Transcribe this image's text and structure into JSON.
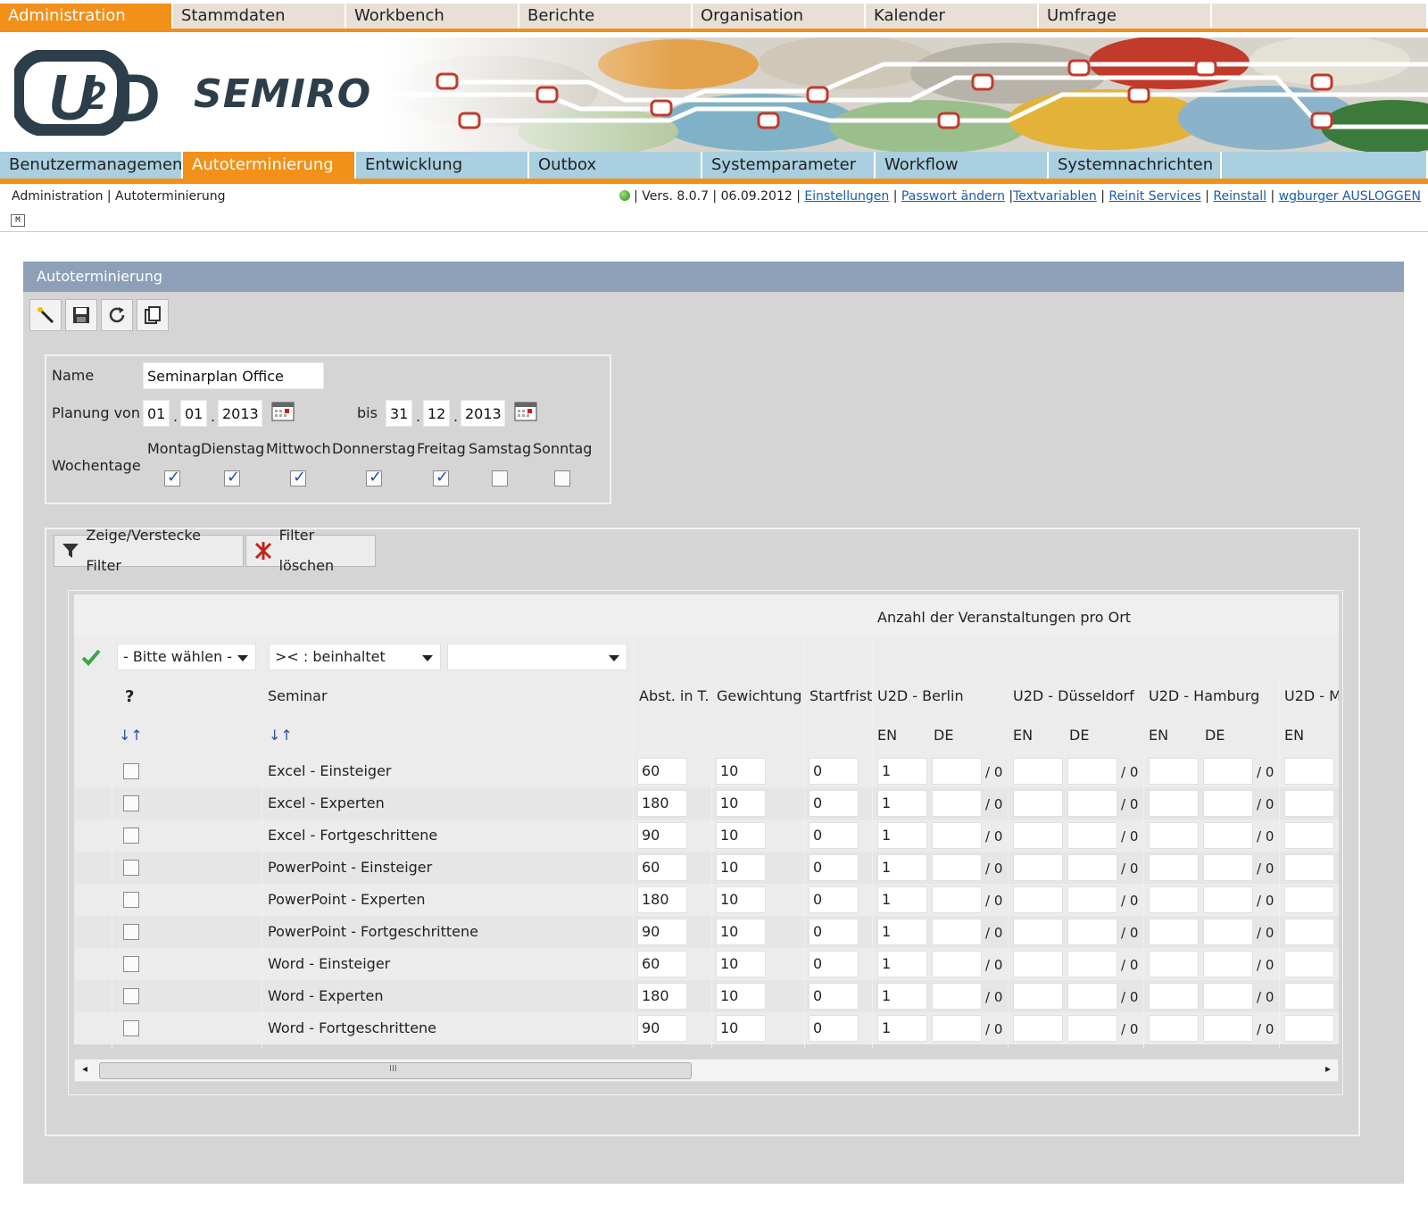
{
  "top_nav": {
    "tabs": [
      "Administration",
      "Stammdaten",
      "Workbench",
      "Berichte",
      "Organisation",
      "Kalender",
      "Umfrage"
    ],
    "active": "Administration"
  },
  "brand": {
    "logo_text": "U2D",
    "product": "SEMIRO"
  },
  "sub_nav": {
    "tabs": [
      "Benutzermanagement",
      "Autoterminierung",
      "Entwicklung",
      "Outbox",
      "Systemparameter",
      "Workflow",
      "Systemnachrichten"
    ],
    "active": "Autoterminierung"
  },
  "info_bar": {
    "breadcrumb": "Administration | Autoterminierung",
    "version": "| Vers. 8.0.7 | 06.09.2012 |",
    "links": [
      "Einstellungen",
      "Passwort ändern",
      "Textvariablen",
      "Reinit Services",
      "Reinstall",
      "wgburger AUSLOGGEN"
    ]
  },
  "panel": {
    "title": "Autoterminierung"
  },
  "form": {
    "name_label": "Name",
    "name_value": "Seminarplan Office",
    "planning_label": "Planung von",
    "from": {
      "day": "01",
      "month": "01",
      "year": "2013"
    },
    "to_label": "bis",
    "to": {
      "day": "31",
      "month": "12",
      "year": "2013"
    },
    "weekdays_label": "Wochentage",
    "weekdays": [
      {
        "name": "Montag",
        "checked": true
      },
      {
        "name": "Dienstag",
        "checked": true
      },
      {
        "name": "Mittwoch",
        "checked": true
      },
      {
        "name": "Donnerstag",
        "checked": true
      },
      {
        "name": "Freitag",
        "checked": true
      },
      {
        "name": "Samstag",
        "checked": false
      },
      {
        "name": "Sonntag",
        "checked": false
      }
    ]
  },
  "filter_bar": {
    "toggle_label": "Zeige/Verstecke Filter",
    "clear_label": "Filter löschen",
    "field_select": "- Bitte wählen -",
    "operator_select": "><  : beinhaltet",
    "filter_value": ""
  },
  "table": {
    "group_header": "Anzahl der Veranstaltungen pro Ort",
    "headers": {
      "help": "?",
      "seminar": "Seminar",
      "abst": "Abst. in T.",
      "gewichtung": "Gewichtung",
      "startfrist": "Startfrist"
    },
    "locations": [
      "U2D - Berlin",
      "U2D - Düsseldorf",
      "U2D - Hamburg",
      "U2D - M"
    ],
    "lang_en": "EN",
    "lang_de": "DE",
    "total_suffix": "/ 0",
    "rows": [
      {
        "seminar": "Excel - Einsteiger",
        "abst": "60",
        "gewichtung": "10",
        "startfrist": "0",
        "berlin_en": "1"
      },
      {
        "seminar": "Excel - Experten",
        "abst": "180",
        "gewichtung": "10",
        "startfrist": "0",
        "berlin_en": "1"
      },
      {
        "seminar": "Excel - Fortgeschrittene",
        "abst": "90",
        "gewichtung": "10",
        "startfrist": "0",
        "berlin_en": "1"
      },
      {
        "seminar": "PowerPoint - Einsteiger",
        "abst": "60",
        "gewichtung": "10",
        "startfrist": "0",
        "berlin_en": "1"
      },
      {
        "seminar": "PowerPoint - Experten",
        "abst": "180",
        "gewichtung": "10",
        "startfrist": "0",
        "berlin_en": "1"
      },
      {
        "seminar": "PowerPoint - Fortgeschrittene",
        "abst": "90",
        "gewichtung": "10",
        "startfrist": "0",
        "berlin_en": "1"
      },
      {
        "seminar": "Word - Einsteiger",
        "abst": "60",
        "gewichtung": "10",
        "startfrist": "0",
        "berlin_en": "1"
      },
      {
        "seminar": "Word - Experten",
        "abst": "180",
        "gewichtung": "10",
        "startfrist": "0",
        "berlin_en": "1"
      },
      {
        "seminar": "Word - Fortgeschrittene",
        "abst": "90",
        "gewichtung": "10",
        "startfrist": "0",
        "berlin_en": "1"
      }
    ]
  },
  "colors": {
    "accent": "#f29019",
    "subnav": "#a9cfe0",
    "panel_header": "#8da0b8",
    "link": "#1a5da8"
  }
}
